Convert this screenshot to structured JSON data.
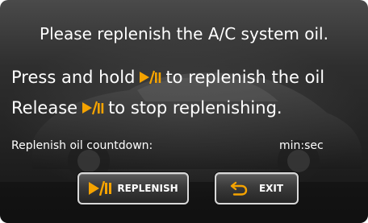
{
  "screen": {
    "title": "Please replenish the A/C system oil.",
    "instruction_line1_prefix": "Press and hold",
    "instruction_line1_suffix": "to replenish the oil",
    "instruction_line2_prefix": "Release",
    "instruction_line2_suffix": "to stop replenishing.",
    "countdown_label": "Replenish oil countdown:",
    "countdown_unit": "min:sec"
  },
  "buttons": {
    "replenish_label": "REPLENISH",
    "exit_label": "EXIT"
  },
  "icons": {
    "play_pause": "play-pause-icon",
    "back": "back-arrow-icon"
  },
  "colors": {
    "accent_icon": "#f5a300",
    "text": "#ffffff",
    "button_border": "#d9d9d9"
  }
}
